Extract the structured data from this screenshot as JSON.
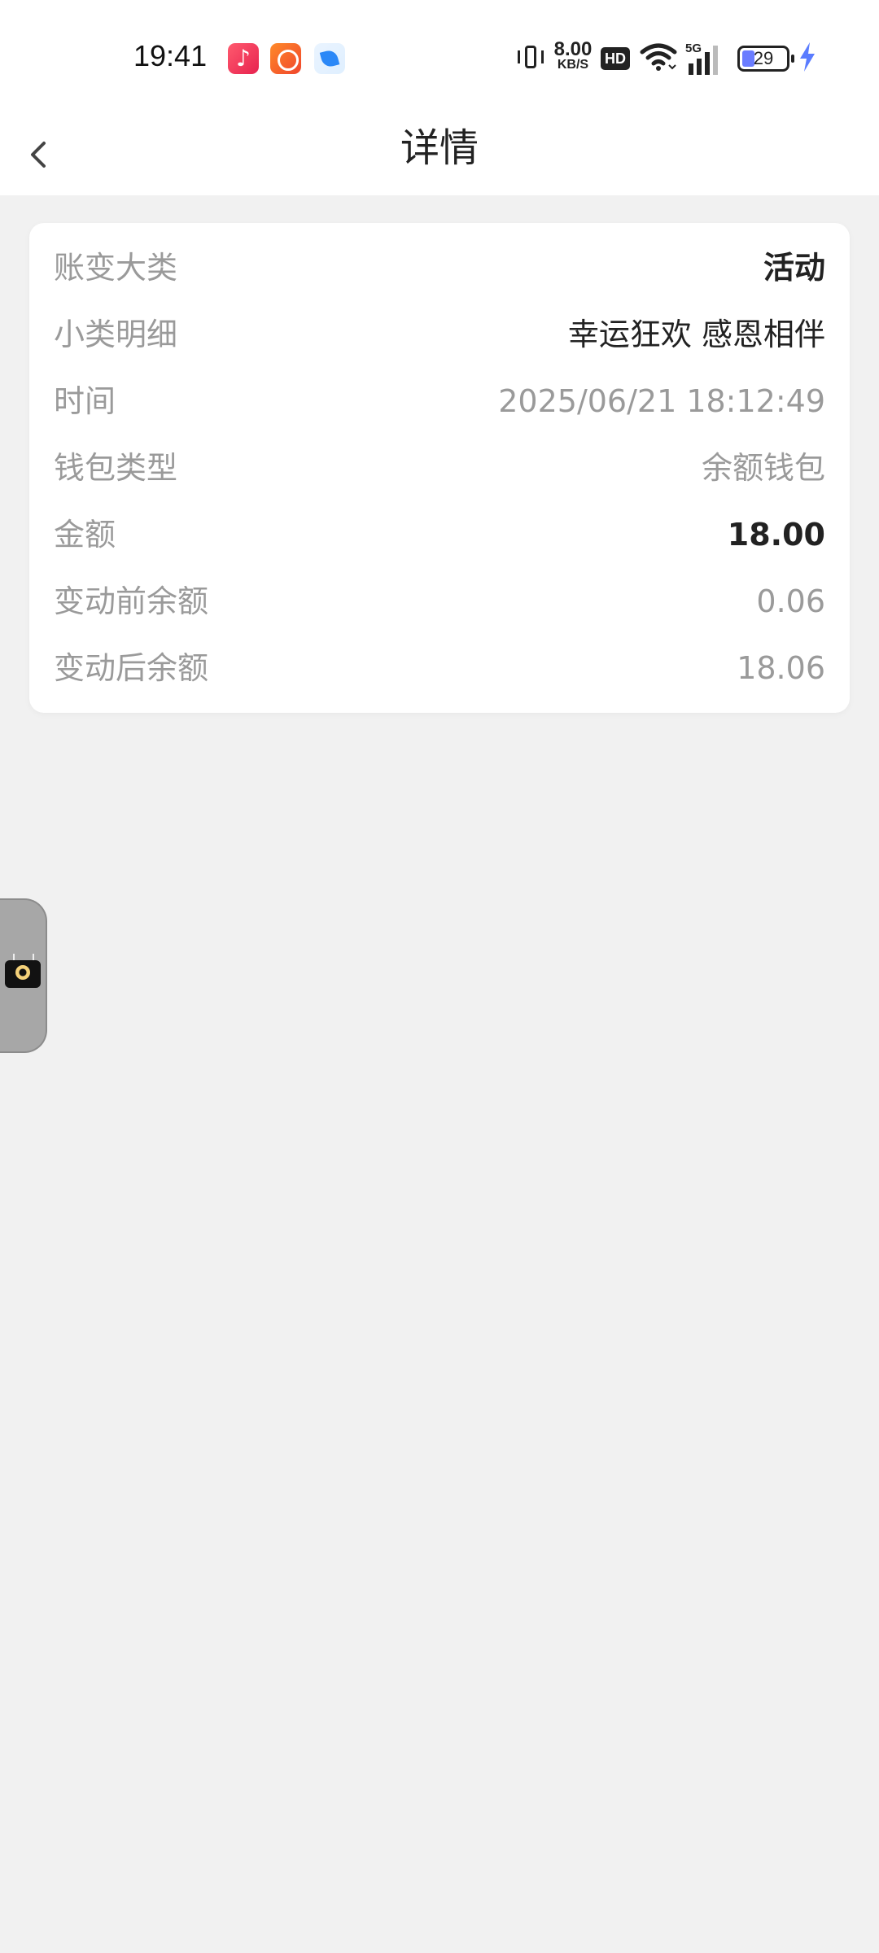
{
  "status_bar": {
    "time": "19:41",
    "apps": [
      "music-app-icon",
      "kuaishou-app-icon",
      "leaf-app-icon"
    ],
    "net_speed_value": "8.00",
    "net_speed_unit": "KB/S",
    "hd_label": "HD",
    "signal_label": "5G",
    "battery_level": "29",
    "colors": {
      "battery_fill": "#6a7cff",
      "bolt": "#5a7cff"
    }
  },
  "header": {
    "title": "详情",
    "back_icon": "chevron-left-icon"
  },
  "details": {
    "rows": [
      {
        "label": "账变大类",
        "value": "活动"
      },
      {
        "label": "小类明细",
        "value": "幸运狂欢  感恩相伴"
      },
      {
        "label": "时间",
        "value": "2025/06/21 18:12:49"
      },
      {
        "label": "钱包类型",
        "value": "余额钱包"
      },
      {
        "label": "金额",
        "value": "18.00"
      },
      {
        "label": "变动前余额",
        "value": "0.06"
      },
      {
        "label": "变动后余额",
        "value": "18.06"
      }
    ]
  },
  "floating_widget": {
    "icon": "tv-soccer-icon"
  }
}
